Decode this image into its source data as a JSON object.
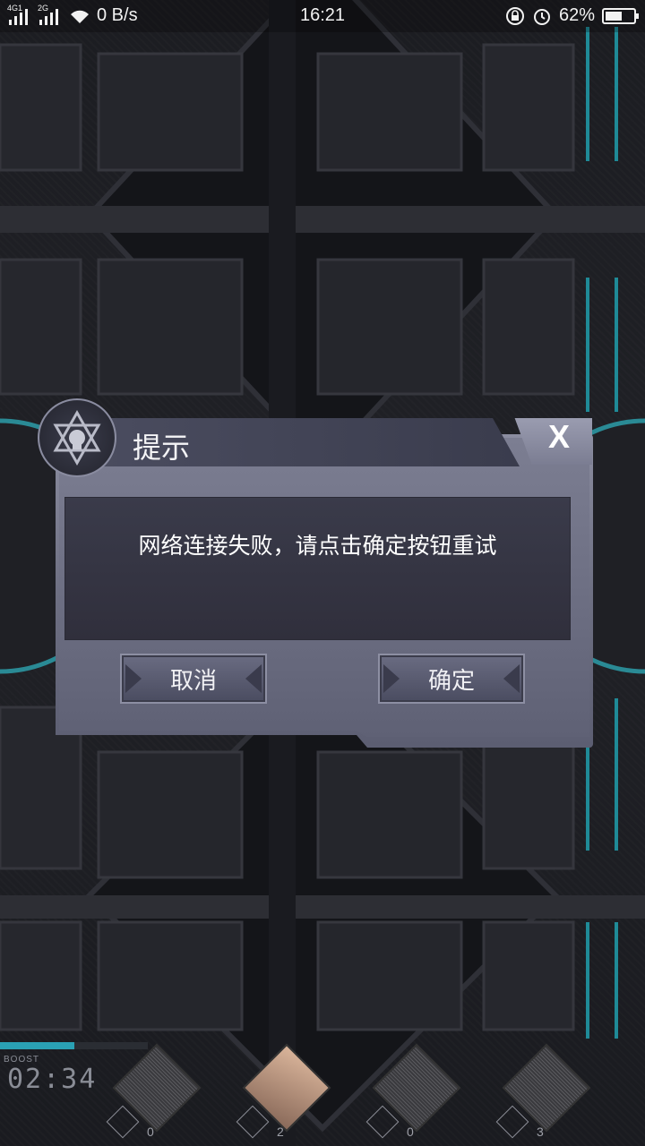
{
  "status_bar": {
    "net_label_1": "4G1",
    "net_label_2": "2G",
    "speed": "0 B/s",
    "time": "16:21",
    "battery": "62%",
    "battery_level": 0.62
  },
  "dialog": {
    "title": "提示",
    "close_label": "X",
    "message": "网络连接失败，请点击确定按钮重试",
    "cancel_label": "取消",
    "ok_label": "确定"
  },
  "hud": {
    "boost_label": "BOOST",
    "timer": "02:34",
    "boost_level": 0.5,
    "slots": [
      {
        "count": "0"
      },
      {
        "count": "2"
      },
      {
        "count": "0"
      },
      {
        "count": "3"
      }
    ]
  },
  "colors": {
    "accent_teal": "#2aa1b4",
    "dialog_frame": "#7c7e92",
    "panel_dark": "#333241"
  }
}
